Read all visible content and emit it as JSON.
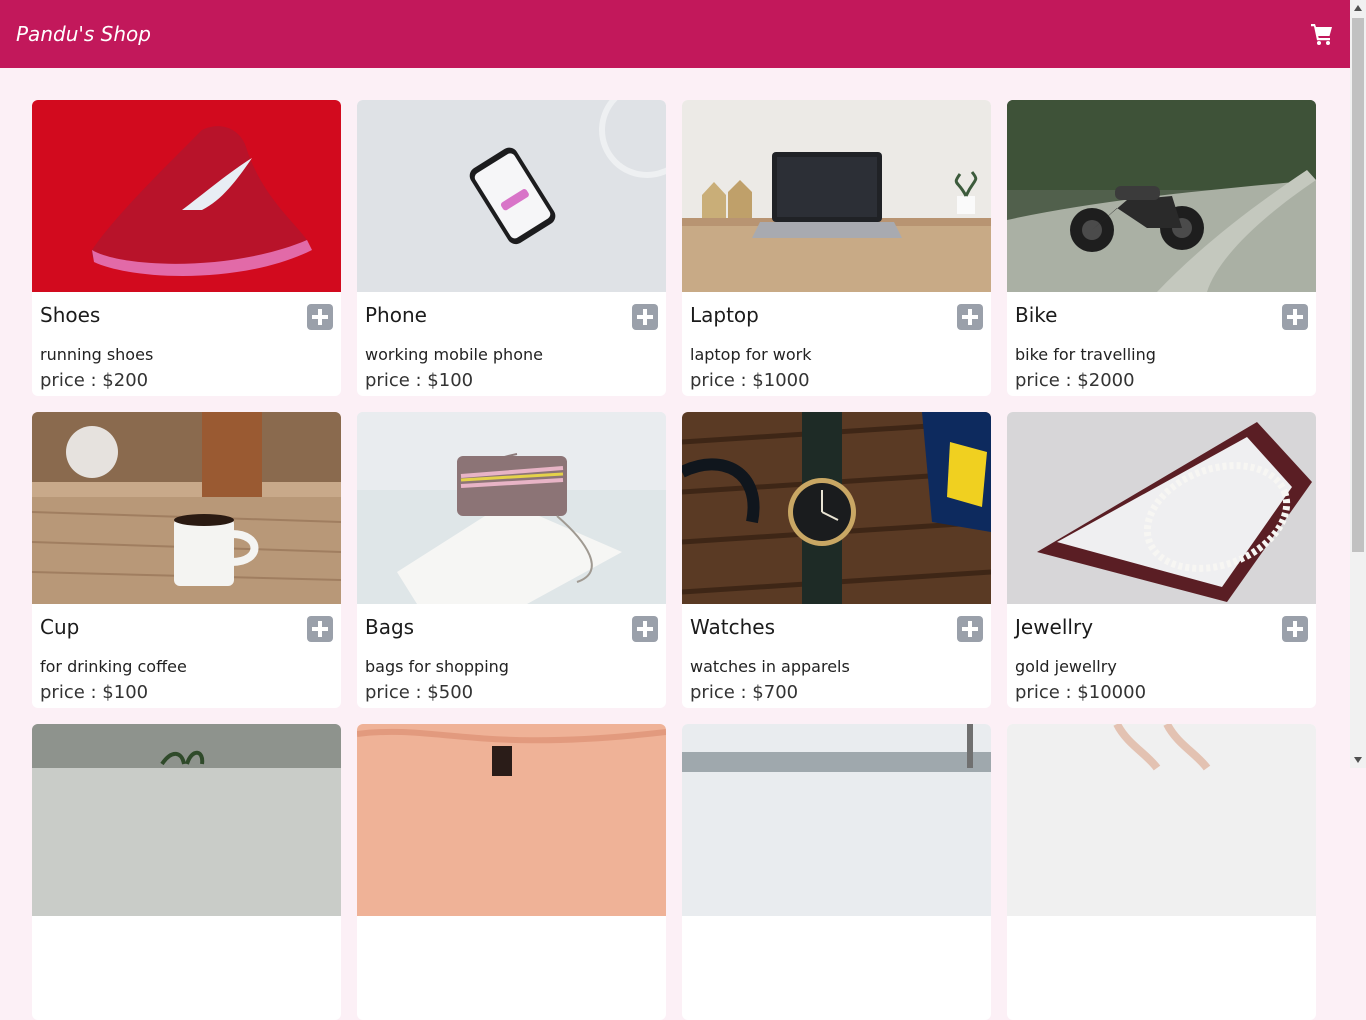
{
  "header": {
    "brand": "Pandu's Shop",
    "cart_icon": "cart-icon",
    "background": "#c2185b"
  },
  "products": [
    {
      "title": "Shoes",
      "description": "running shoes",
      "price": "price : $200",
      "image": "red-sneaker"
    },
    {
      "title": "Phone",
      "description": "working mobile phone",
      "price": "price : $100",
      "image": "smartphone"
    },
    {
      "title": "Laptop",
      "description": "laptop for work",
      "price": "price : $1000",
      "image": "laptop-on-desk"
    },
    {
      "title": "Bike",
      "description": "bike for travelling",
      "price": "price : $2000",
      "image": "motorcycle"
    },
    {
      "title": "Cup",
      "description": "for drinking coffee",
      "price": "price : $100",
      "image": "coffee-mug"
    },
    {
      "title": "Bags",
      "description": "bags for shopping",
      "price": "price : $500",
      "image": "handbag"
    },
    {
      "title": "Watches",
      "description": "watches in apparels",
      "price": "price : $700",
      "image": "wristwatch"
    },
    {
      "title": "Jewellry",
      "description": "gold jewellry",
      "price": "price : $10000",
      "image": "pearl-necklace"
    }
  ],
  "add_icon": "plus-square-icon"
}
